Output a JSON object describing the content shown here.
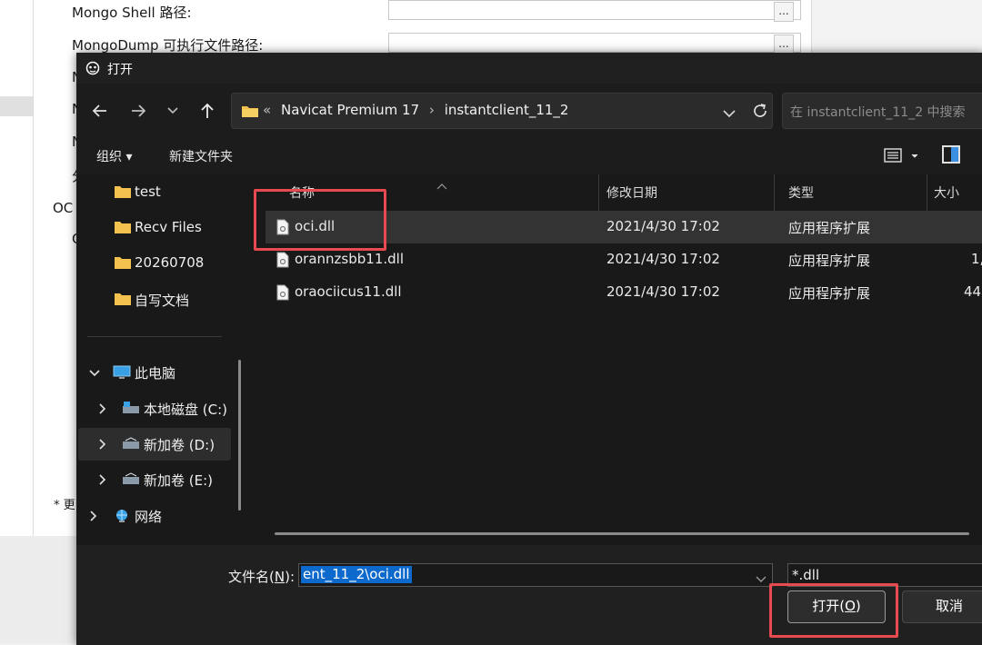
{
  "background": {
    "labels": [
      "Mongo Shell 路径:",
      "MongoDump 可执行文件路径:",
      "N",
      "N",
      "N",
      "分",
      "OC",
      "C",
      "* 更"
    ],
    "browse": "..."
  },
  "dialog": {
    "title": "打开",
    "address": {
      "overflow": "«",
      "crumbs": [
        "Navicat Premium 17",
        "instantclient_11_2"
      ]
    },
    "search_placeholder": "在 instantclient_11_2 中搜索",
    "commands": {
      "organize": "组织 ▾",
      "new_folder": "新建文件夹"
    },
    "nav": [
      {
        "label": "test",
        "icon": "folder-icon"
      },
      {
        "label": "Recv Files",
        "icon": "folder-icon"
      },
      {
        "label": "20260708",
        "icon": "folder-icon"
      },
      {
        "label": "自写文档",
        "icon": "folder-icon"
      },
      {
        "label": "此电脑",
        "icon": "computer-icon"
      },
      {
        "label": "本地磁盘 (C:)",
        "icon": "drive-icon"
      },
      {
        "label": "新加卷 (D:)",
        "icon": "drive-icon"
      },
      {
        "label": "新加卷 (E:)",
        "icon": "drive-icon"
      },
      {
        "label": "网络",
        "icon": "network-icon"
      }
    ],
    "columns": [
      "名称",
      "修改日期",
      "类型",
      "大小"
    ],
    "files": [
      {
        "name": "oci.dll",
        "date": "2021/4/30 17:02",
        "type": "应用程序扩展",
        "size": ""
      },
      {
        "name": "orannzsbb11.dll",
        "date": "2021/4/30 17:02",
        "type": "应用程序扩展",
        "size": "1,"
      },
      {
        "name": "oraociicus11.dll",
        "date": "2021/4/30 17:02",
        "type": "应用程序扩展",
        "size": "44,"
      }
    ],
    "filename_label_text": "文件名(",
    "filename_label_key": "N",
    "filename_label_end": "):",
    "filename_value": "ent_11_2\\oci.dll",
    "filter": "*.dll",
    "open_text": "打开(",
    "open_key": "O",
    "open_end": ")",
    "cancel": "取消"
  },
  "colors": {
    "dialog_bg": "#202020",
    "selection": "#0e69cc",
    "annotation": "#e84a4f",
    "folder": "#f2c14e"
  }
}
